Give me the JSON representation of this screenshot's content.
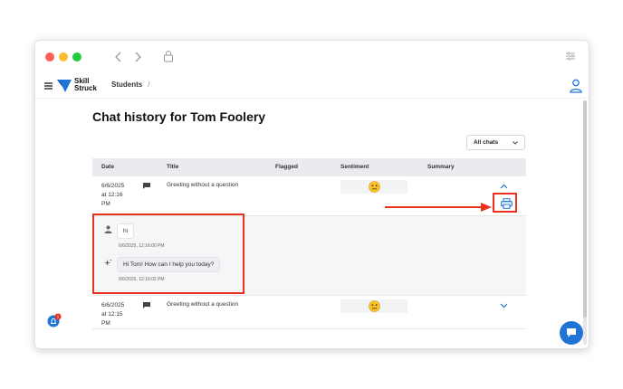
{
  "app": {
    "logo_line1": "Skill",
    "logo_line2": "Struck",
    "breadcrumb": {
      "item": "Students",
      "separator": "/"
    },
    "accent_color": "#1f74d8",
    "highlight_color": "#e8321e"
  },
  "page": {
    "title": "Chat history for Tom Foolery",
    "filter": {
      "selected": "All chats"
    }
  },
  "table": {
    "columns": [
      "Date",
      "Title",
      "Flagged",
      "Sentiment",
      "Summary"
    ],
    "rows": [
      {
        "date": [
          "6/6/2025",
          "at 12:16",
          "PM"
        ],
        "title": "Greeting without a question",
        "sentiment_icon": "neutral-face-emoji",
        "expanded": true,
        "messages": [
          {
            "sender": "user",
            "icon": "user-icon",
            "text": "hi",
            "timestamp": "6/6/2025, 12:16:00 PM"
          },
          {
            "sender": "assistant",
            "icon": "sparkle-icon",
            "text": "Hi Tom! How can I help you today?",
            "timestamp": "6/6/2025, 12:16:02 PM"
          }
        ]
      },
      {
        "date": [
          "6/6/2025",
          "at 12:15",
          "PM"
        ],
        "title": "Greeting without a question",
        "sentiment_icon": "neutral-face-emoji",
        "expanded": false
      }
    ]
  },
  "notifications": {
    "badge": "1"
  }
}
